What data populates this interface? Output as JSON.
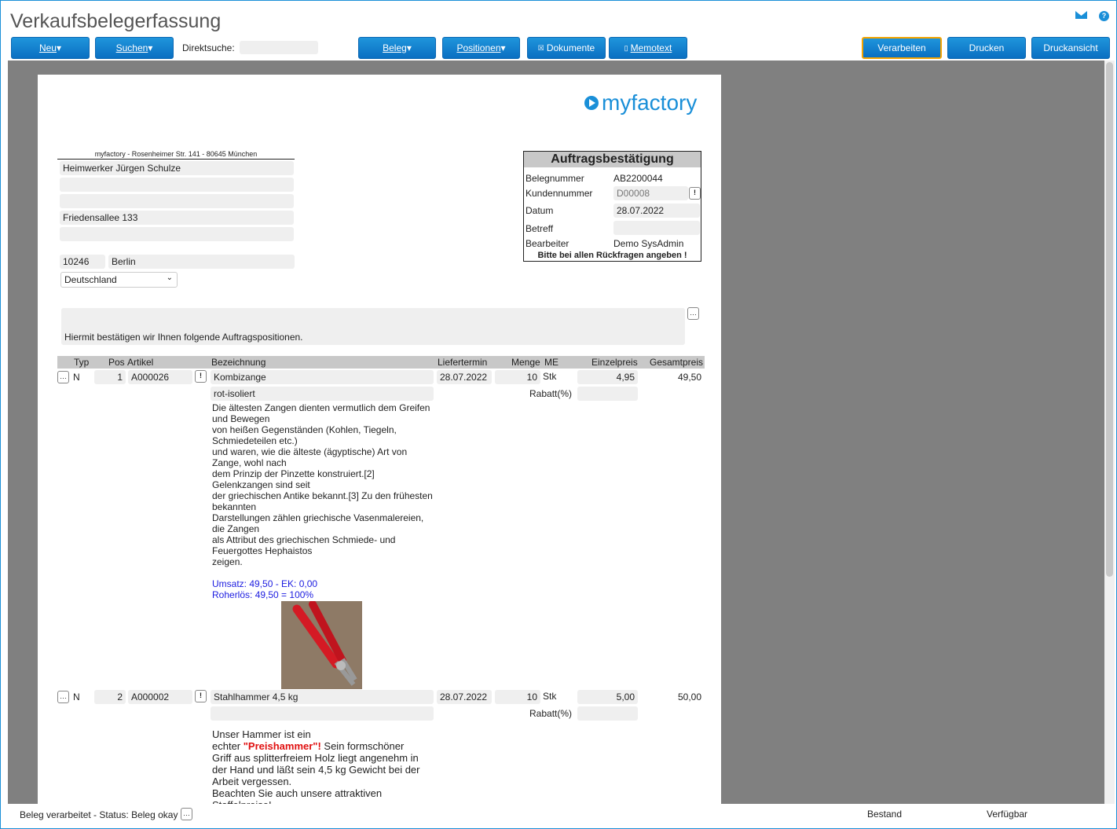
{
  "title": "Verkaufsbelegerfassung",
  "toolbar": {
    "neu": "Neu",
    "suchen": "Suchen",
    "direktsuche_label": "Direktsuche:",
    "direktsuche_value": "",
    "beleg": "Beleg",
    "positionen": "Positionen",
    "dokumente": "Dokumente",
    "memotext": "Memotext",
    "verarbeiten": "Verarbeiten",
    "drucken": "Drucken",
    "druckansicht": "Druckansicht"
  },
  "logo": "myfactory",
  "sender": "myfactory - Rosenheimer Str. 141 - 80645 München",
  "address": {
    "line1": "Heimwerker Jürgen Schulze",
    "line2": "",
    "line3": "",
    "street": "Friedensallee 133",
    "line5": "",
    "zip": "10246",
    "city": "Berlin",
    "country": "Deutschland"
  },
  "docbox": {
    "title": "Auftragsbestätigung",
    "belegnummer_label": "Belegnummer",
    "belegnummer": "AB2200044",
    "kundennummer_label": "Kundennummer",
    "kundennummer": "D00008",
    "datum_label": "Datum",
    "datum": "28.07.2022",
    "betreff_label": "Betreff",
    "betreff": "",
    "bearbeiter_label": "Bearbeiter",
    "bearbeiter": "Demo SysAdmin",
    "note": "Bitte bei allen Rückfragen angeben !"
  },
  "intro": "Hiermit bestätigen wir Ihnen folgende Auftragspositionen.",
  "columns": {
    "typ": "Typ",
    "pos": "Pos",
    "artikel": "Artikel",
    "bezeichnung": "Bezeichnung",
    "liefertermin": "Liefertermin",
    "menge": "Menge",
    "me": "ME",
    "einzelpreis": "Einzelpreis",
    "gesamtpreis": "Gesamtpreis"
  },
  "rabatt_label": "Rabatt(%)",
  "positions": [
    {
      "typ": "N",
      "pos": "1",
      "artikel": "A000026",
      "bezeichnung": "Kombizange",
      "zusatz": "rot-isoliert",
      "liefertermin": "28.07.2022",
      "menge": "10",
      "me": "Stk",
      "einzelpreis": "4,95",
      "gesamtpreis": "49,50",
      "rabatt": "",
      "text": "Die ältesten Zangen dienten vermutlich dem Greifen\nund Bewegen\nvon heißen Gegenständen (Kohlen, Tiegeln,\nSchmiedeteilen etc.)\nund waren, wie die älteste (ägyptische) Art von\nZange, wohl nach\ndem Prinzip der Pinzette konstruiert.[2]\nGelenkzangen sind seit\nder griechischen Antike bekannt.[3] Zu den frühesten\nbekannten\nDarstellungen zählen griechische Vasenmalereien,\ndie Zangen\nals Attribut des griechischen Schmiede- und\nFeuergottes Hephaistos\nzeigen.",
      "umsatz": "Umsatz: 49,50 - EK: 0,00",
      "rohertrag": "Roherlös: 49,50 = 100%"
    },
    {
      "typ": "N",
      "pos": "2",
      "artikel": "A000002",
      "bezeichnung": "Stahlhammer 4,5 kg",
      "zusatz": "",
      "liefertermin": "28.07.2022",
      "menge": "10",
      "me": "Stk",
      "einzelpreis": "5,00",
      "gesamtpreis": "50,00",
      "rabatt": "",
      "text1": "Unser Hammer ist ein\nechter ",
      "highlight": "\"Preishammer\"!",
      "text2": " Sein formschöner\nGriff aus splitterfreiem Holz liegt angenehm in\nder Hand und läßt sein 4,5 kg Gewicht bei der\nArbeit vergessen.\nBeachten Sie auch unsere attraktiven\nStaffelpreise!"
    }
  ],
  "status": {
    "text": "Beleg verarbeitet - Status: Beleg okay",
    "bestand": "Bestand",
    "verfuegbar": "Verfügbar"
  }
}
